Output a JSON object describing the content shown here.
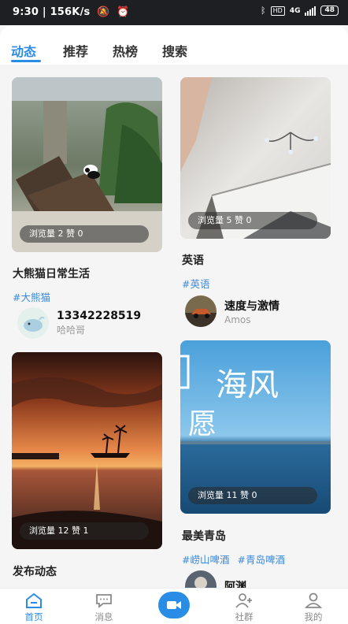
{
  "status_bar": {
    "time": "9:30",
    "speed": "156K/s",
    "network": "4G",
    "battery": "48"
  },
  "tabs": [
    {
      "label": "动态",
      "active": true
    },
    {
      "label": "推荐",
      "active": false
    },
    {
      "label": "热榜",
      "active": false
    },
    {
      "label": "搜索",
      "active": false
    }
  ],
  "posts": [
    {
      "stats": "浏览量 2 赞 0",
      "title": "大熊猫日常生活",
      "tags": [
        "#大熊猫"
      ],
      "author": {
        "name": "13342228519",
        "subtitle": "哈哈哥"
      }
    },
    {
      "stats": "浏览量 5 赞 0",
      "title": "英语",
      "tags": [
        "#英语"
      ],
      "author": {
        "name": "速度与激情",
        "subtitle": "Amos"
      }
    },
    {
      "stats": "浏览量 12 赞 1",
      "title": "发布动态",
      "tags": [],
      "author": null
    },
    {
      "stats": "浏览量 11 赞 0",
      "title": "最美青岛",
      "tags": [
        "#崂山啤酒",
        "#青岛啤酒"
      ],
      "author": {
        "name": "阿渊",
        "subtitle": ""
      },
      "cover_text": "海风 愿"
    }
  ],
  "bottom_nav": [
    {
      "label": "首页",
      "icon": "home-icon",
      "active": true
    },
    {
      "label": "消息",
      "icon": "message-icon",
      "active": false
    },
    {
      "label": "",
      "icon": "video-camera-icon",
      "active": false
    },
    {
      "label": "社群",
      "icon": "community-icon",
      "active": false
    },
    {
      "label": "我的",
      "icon": "profile-icon",
      "active": false
    }
  ],
  "colors": {
    "accent": "#2a8de5",
    "tag": "#3c8ad9",
    "status_bar": "#1d1f23"
  }
}
